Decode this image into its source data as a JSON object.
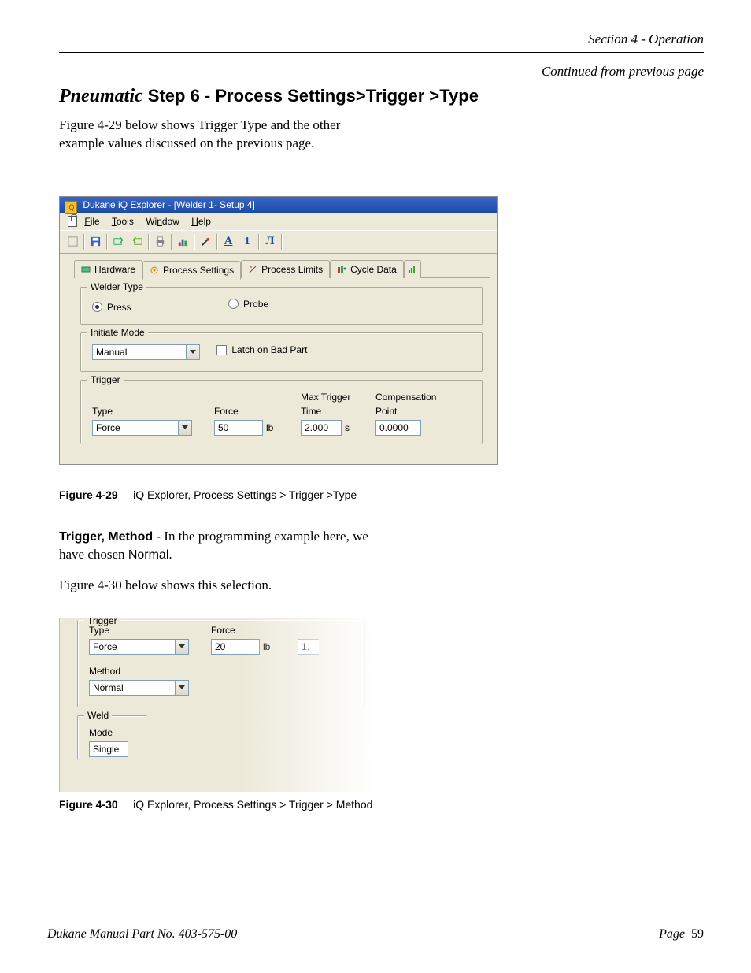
{
  "header": {
    "section": "Section 4 - Operation",
    "continued": "Continued from previous page"
  },
  "title": {
    "italic": "Pneumatic",
    "bold": " Step 6 - Process Settings>Trigger >Type"
  },
  "intro": "Figure 4-29 below shows Trigger Type and the other example values discussed on the previous page.",
  "fig29": {
    "windowTitle": "Dukane iQ Explorer - [Welder 1- Setup 4]",
    "menu": {
      "file": "File",
      "tools": "Tools",
      "window": "Window",
      "help": "Help"
    },
    "toolbar": {
      "a_label": "A",
      "one_label": "1"
    },
    "tabs": {
      "hardware": "Hardware",
      "process_settings": "Process Settings",
      "process_limits": "Process Limits",
      "cycle_data": "Cycle Data"
    },
    "welderType": {
      "legend": "Welder Type",
      "press": "Press",
      "probe": "Probe"
    },
    "initiate": {
      "legend": "Initiate Mode",
      "mode": "Manual",
      "latch": "Latch on Bad Part"
    },
    "trigger": {
      "legend": "Trigger",
      "type_lab": "Type",
      "type_val": "Force",
      "force_lab": "Force",
      "force_val": "50",
      "force_unit": "lb",
      "max_lab1": "Max Trigger",
      "max_lab2": "Time",
      "max_val": "2.000",
      "max_unit": "s",
      "comp_lab1": "Compensation",
      "comp_lab2": "Point",
      "comp_val": "0.0000"
    }
  },
  "fig29cap": {
    "b": "Figure 4-29",
    "rest": "iQ Explorer, Process Settings > Trigger >Type"
  },
  "para2": {
    "b": "Trigger, Method",
    "rest1": " - In the programming example here, we have chosen ",
    "sans": "Normal",
    "period": "."
  },
  "para3": "Figure 4-30 below shows this selection.",
  "fig30": {
    "trigger": {
      "legend": "Trigger",
      "type_lab": "Type",
      "type_val": "Force",
      "force_lab": "Force",
      "force_val": "20",
      "force_unit": "lb",
      "partial": "1.",
      "method_lab": "Method",
      "method_val": "Normal"
    },
    "weld": {
      "legend": "Weld",
      "mode_lab": "Mode",
      "mode_val": "Single "
    }
  },
  "fig30cap": {
    "b": "Figure 4-30",
    "rest": "iQ Explorer, Process Settings > Trigger > Method"
  },
  "footer": {
    "part": "Dukane Manual Part No. 403-575-00",
    "page_label": "Page",
    "page_num": "59"
  }
}
